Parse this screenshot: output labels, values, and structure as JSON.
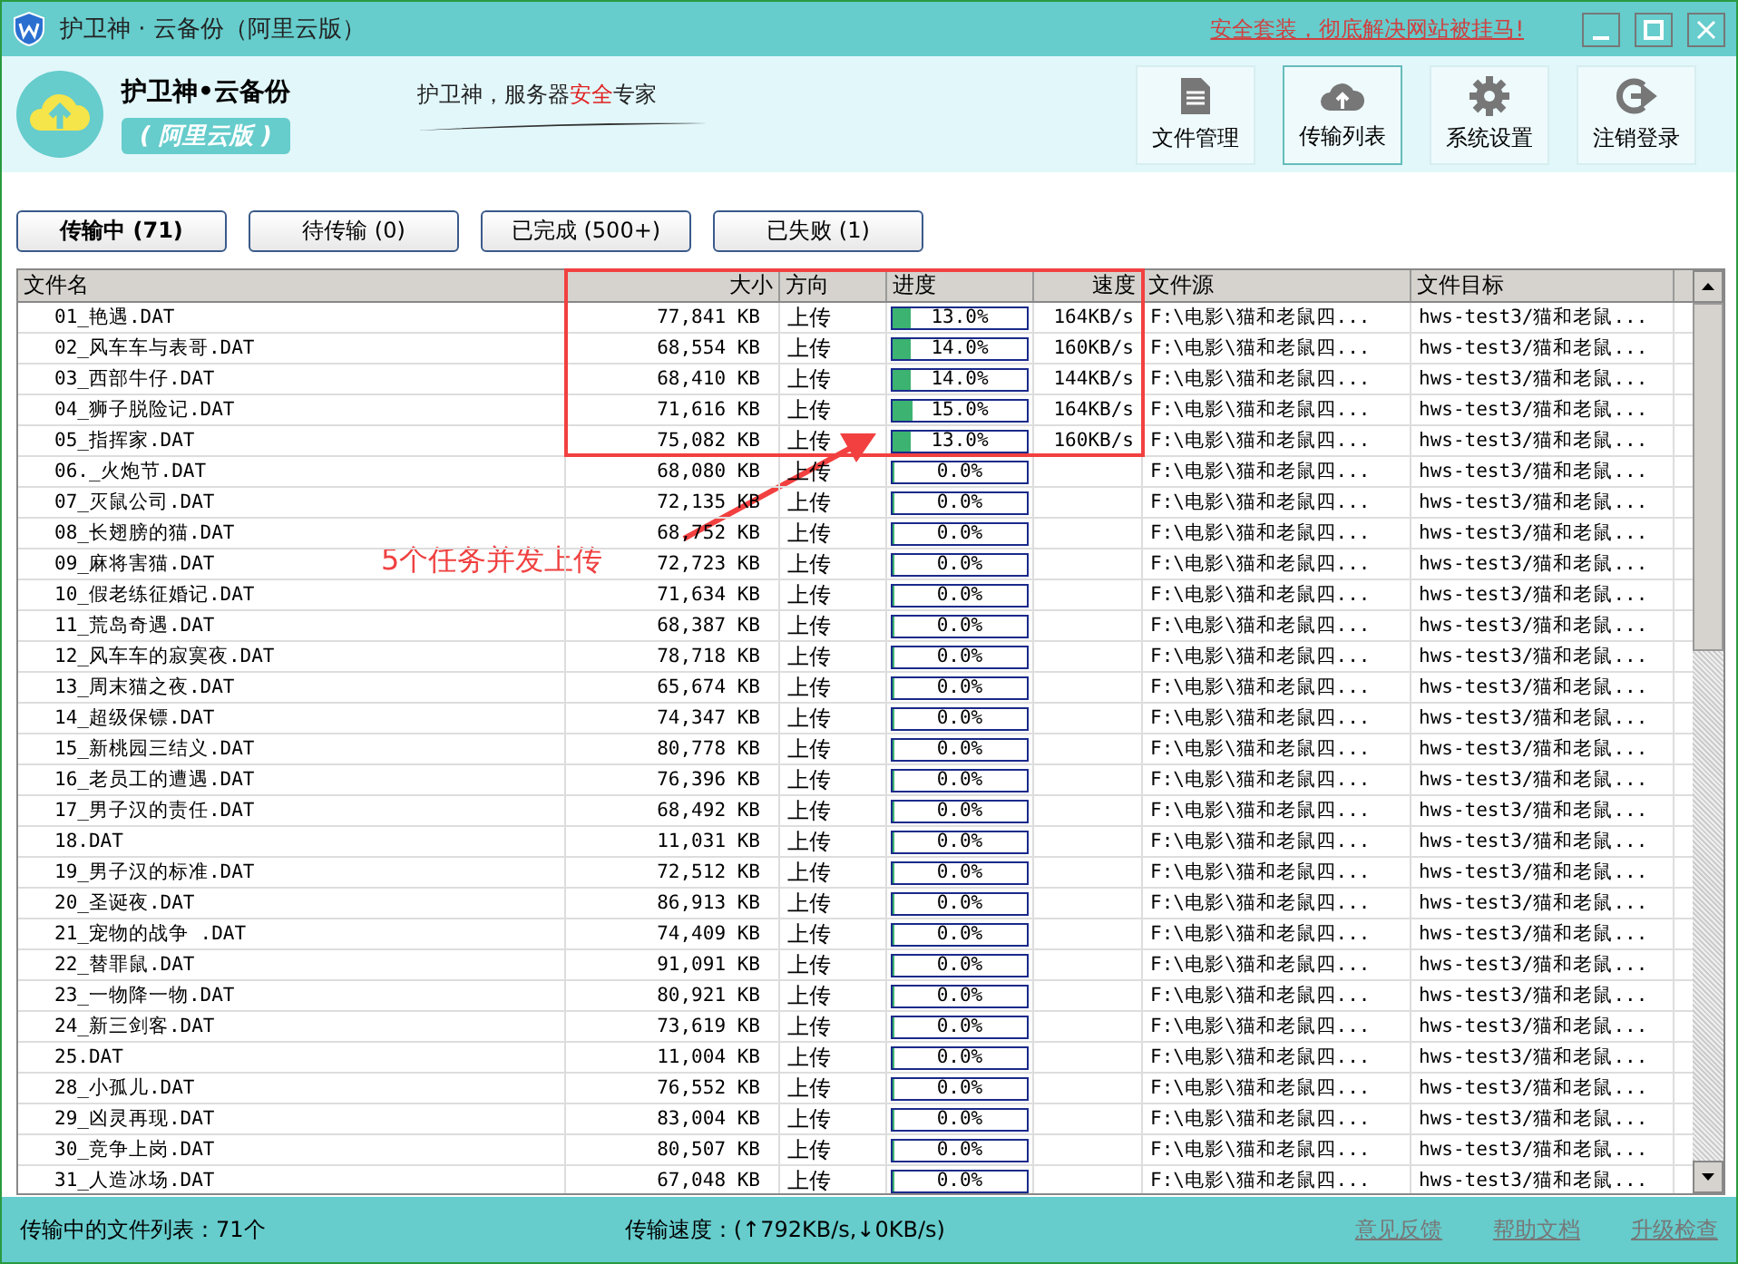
{
  "window": {
    "title": "护卫神 · 云备份（阿里云版）",
    "promo_link": "安全套装，彻底解决网站被挂马!"
  },
  "header": {
    "product_name": "护卫神•云备份",
    "edition": "( 阿里云版 )",
    "slogan": [
      {
        "text": "护卫神，服务器",
        "highlight": false
      },
      {
        "text": "安全",
        "highlight": true
      },
      {
        "text": "专家",
        "highlight": false
      }
    ],
    "nav": [
      {
        "kind": "document",
        "label": "文件管理",
        "selected": false
      },
      {
        "kind": "cloud",
        "label": "传输列表",
        "selected": true
      },
      {
        "kind": "gear",
        "label": "系统设置",
        "selected": false
      },
      {
        "kind": "logout",
        "label": "注销登录",
        "selected": false
      }
    ]
  },
  "tabs": [
    {
      "label": "传输中 (71)",
      "selected": true
    },
    {
      "label": "待传输 (0)",
      "selected": false
    },
    {
      "label": "已完成 (500+)",
      "selected": false
    },
    {
      "label": "已失败 (1)",
      "selected": false
    }
  ],
  "table": {
    "columns": [
      "文件名",
      "大小",
      "方向",
      "进度",
      "速度",
      "文件源",
      "文件目标"
    ],
    "rows": [
      {
        "name": "01_艳遇.DAT",
        "size": "77,841 KB",
        "direction": "上传",
        "progress": "13.0%",
        "level": 0.13,
        "speed": "164KB/s",
        "source": "F:\\电影\\猫和老鼠四...",
        "target": "hws-test3/猫和老鼠..."
      },
      {
        "name": "02_风车车与表哥.DAT",
        "size": "68,554 KB",
        "direction": "上传",
        "progress": "14.0%",
        "level": 0.14,
        "speed": "160KB/s",
        "source": "F:\\电影\\猫和老鼠四...",
        "target": "hws-test3/猫和老鼠..."
      },
      {
        "name": "03_西部牛仔.DAT",
        "size": "68,410 KB",
        "direction": "上传",
        "progress": "14.0%",
        "level": 0.14,
        "speed": "144KB/s",
        "source": "F:\\电影\\猫和老鼠四...",
        "target": "hws-test3/猫和老鼠..."
      },
      {
        "name": "04_狮子脱险记.DAT",
        "size": "71,616 KB",
        "direction": "上传",
        "progress": "15.0%",
        "level": 0.15,
        "speed": "164KB/s",
        "source": "F:\\电影\\猫和老鼠四...",
        "target": "hws-test3/猫和老鼠..."
      },
      {
        "name": "05_指挥家.DAT",
        "size": "75,082 KB",
        "direction": "上传",
        "progress": "13.0%",
        "level": 0.13,
        "speed": "160KB/s",
        "source": "F:\\电影\\猫和老鼠四...",
        "target": "hws-test3/猫和老鼠..."
      },
      {
        "name": "06._火炮节.DAT",
        "size": "68,080 KB",
        "direction": "上传",
        "progress": "0.0%",
        "level": 0,
        "source": "F:\\电影\\猫和老鼠四...",
        "target": "hws-test3/猫和老鼠..."
      },
      {
        "name": "07_灭鼠公司.DAT",
        "size": "72,135 KB",
        "direction": "上传",
        "progress": "0.0%",
        "level": 0,
        "source": "F:\\电影\\猫和老鼠四...",
        "target": "hws-test3/猫和老鼠..."
      },
      {
        "name": "08_长翅膀的猫.DAT",
        "size": "68,752 KB",
        "direction": "上传",
        "progress": "0.0%",
        "level": 0,
        "source": "F:\\电影\\猫和老鼠四...",
        "target": "hws-test3/猫和老鼠..."
      },
      {
        "name": "09_麻将害猫.DAT",
        "size": "72,723 KB",
        "direction": "上传",
        "progress": "0.0%",
        "level": 0,
        "source": "F:\\电影\\猫和老鼠四...",
        "target": "hws-test3/猫和老鼠..."
      },
      {
        "name": "10_假老练征婚记.DAT",
        "size": "71,634 KB",
        "direction": "上传",
        "progress": "0.0%",
        "level": 0,
        "source": "F:\\电影\\猫和老鼠四...",
        "target": "hws-test3/猫和老鼠..."
      },
      {
        "name": "11_荒岛奇遇.DAT",
        "size": "68,387 KB",
        "direction": "上传",
        "progress": "0.0%",
        "level": 0,
        "source": "F:\\电影\\猫和老鼠四...",
        "target": "hws-test3/猫和老鼠..."
      },
      {
        "name": "12_风车车的寂寞夜.DAT",
        "size": "78,718 KB",
        "direction": "上传",
        "progress": "0.0%",
        "level": 0,
        "source": "F:\\电影\\猫和老鼠四...",
        "target": "hws-test3/猫和老鼠..."
      },
      {
        "name": "13_周末猫之夜.DAT",
        "size": "65,674 KB",
        "direction": "上传",
        "progress": "0.0%",
        "level": 0,
        "source": "F:\\电影\\猫和老鼠四...",
        "target": "hws-test3/猫和老鼠..."
      },
      {
        "name": "14_超级保镖.DAT",
        "size": "74,347 KB",
        "direction": "上传",
        "progress": "0.0%",
        "level": 0,
        "source": "F:\\电影\\猫和老鼠四...",
        "target": "hws-test3/猫和老鼠..."
      },
      {
        "name": "15_新桃园三结义.DAT",
        "size": "80,778 KB",
        "direction": "上传",
        "progress": "0.0%",
        "level": 0,
        "source": "F:\\电影\\猫和老鼠四...",
        "target": "hws-test3/猫和老鼠..."
      },
      {
        "name": "16_老员工的遭遇.DAT",
        "size": "76,396 KB",
        "direction": "上传",
        "progress": "0.0%",
        "level": 0,
        "source": "F:\\电影\\猫和老鼠四...",
        "target": "hws-test3/猫和老鼠..."
      },
      {
        "name": "17_男子汉的责任.DAT",
        "size": "68,492 KB",
        "direction": "上传",
        "progress": "0.0%",
        "level": 0,
        "source": "F:\\电影\\猫和老鼠四...",
        "target": "hws-test3/猫和老鼠..."
      },
      {
        "name": "18.DAT",
        "size": "11,031 KB",
        "direction": "上传",
        "progress": "0.0%",
        "level": 0,
        "source": "F:\\电影\\猫和老鼠四...",
        "target": "hws-test3/猫和老鼠..."
      },
      {
        "name": "19_男子汉的标准.DAT",
        "size": "72,512 KB",
        "direction": "上传",
        "progress": "0.0%",
        "level": 0,
        "source": "F:\\电影\\猫和老鼠四...",
        "target": "hws-test3/猫和老鼠..."
      },
      {
        "name": "20_圣诞夜.DAT",
        "size": "86,913 KB",
        "direction": "上传",
        "progress": "0.0%",
        "level": 0,
        "source": "F:\\电影\\猫和老鼠四...",
        "target": "hws-test3/猫和老鼠..."
      },
      {
        "name": "21_宠物的战争 .DAT",
        "size": "74,409 KB",
        "direction": "上传",
        "progress": "0.0%",
        "level": 0,
        "source": "F:\\电影\\猫和老鼠四...",
        "target": "hws-test3/猫和老鼠..."
      },
      {
        "name": "22_替罪鼠.DAT",
        "size": "91,091 KB",
        "direction": "上传",
        "progress": "0.0%",
        "level": 0,
        "source": "F:\\电影\\猫和老鼠四...",
        "target": "hws-test3/猫和老鼠..."
      },
      {
        "name": "23_一物降一物.DAT",
        "size": "80,921 KB",
        "direction": "上传",
        "progress": "0.0%",
        "level": 0,
        "source": "F:\\电影\\猫和老鼠四...",
        "target": "hws-test3/猫和老鼠..."
      },
      {
        "name": "24_新三剑客.DAT",
        "size": "73,619 KB",
        "direction": "上传",
        "progress": "0.0%",
        "level": 0,
        "source": "F:\\电影\\猫和老鼠四...",
        "target": "hws-test3/猫和老鼠..."
      },
      {
        "name": "25.DAT",
        "size": "11,004 KB",
        "direction": "上传",
        "progress": "0.0%",
        "level": 0,
        "source": "F:\\电影\\猫和老鼠四...",
        "target": "hws-test3/猫和老鼠..."
      },
      {
        "name": "28_小孤儿.DAT",
        "size": "76,552 KB",
        "direction": "上传",
        "progress": "0.0%",
        "level": 0,
        "source": "F:\\电影\\猫和老鼠四...",
        "target": "hws-test3/猫和老鼠..."
      },
      {
        "name": "29_凶灵再现.DAT",
        "size": "83,004 KB",
        "direction": "上传",
        "progress": "0.0%",
        "level": 0,
        "source": "F:\\电影\\猫和老鼠四...",
        "target": "hws-test3/猫和老鼠..."
      },
      {
        "name": "30_竞争上岗.DAT",
        "size": "80,507 KB",
        "direction": "上传",
        "progress": "0.0%",
        "level": 0,
        "source": "F:\\电影\\猫和老鼠四...",
        "target": "hws-test3/猫和老鼠..."
      },
      {
        "name": "31_人造冰场.DAT",
        "size": "67,048 KB",
        "direction": "上传",
        "progress": "0.0%",
        "level": 0,
        "source": "F:\\电影\\猫和老鼠四...",
        "target": "hws-test3/猫和老鼠..."
      }
    ]
  },
  "annotation": {
    "text": "5个任务并发上传"
  },
  "status_bar": {
    "count": "传输中的文件列表：71个",
    "speed": "传输速度：(↑792KB/s,↓0KB/s)",
    "links": [
      "意见反馈",
      "帮助文档",
      "升级检查"
    ]
  }
}
